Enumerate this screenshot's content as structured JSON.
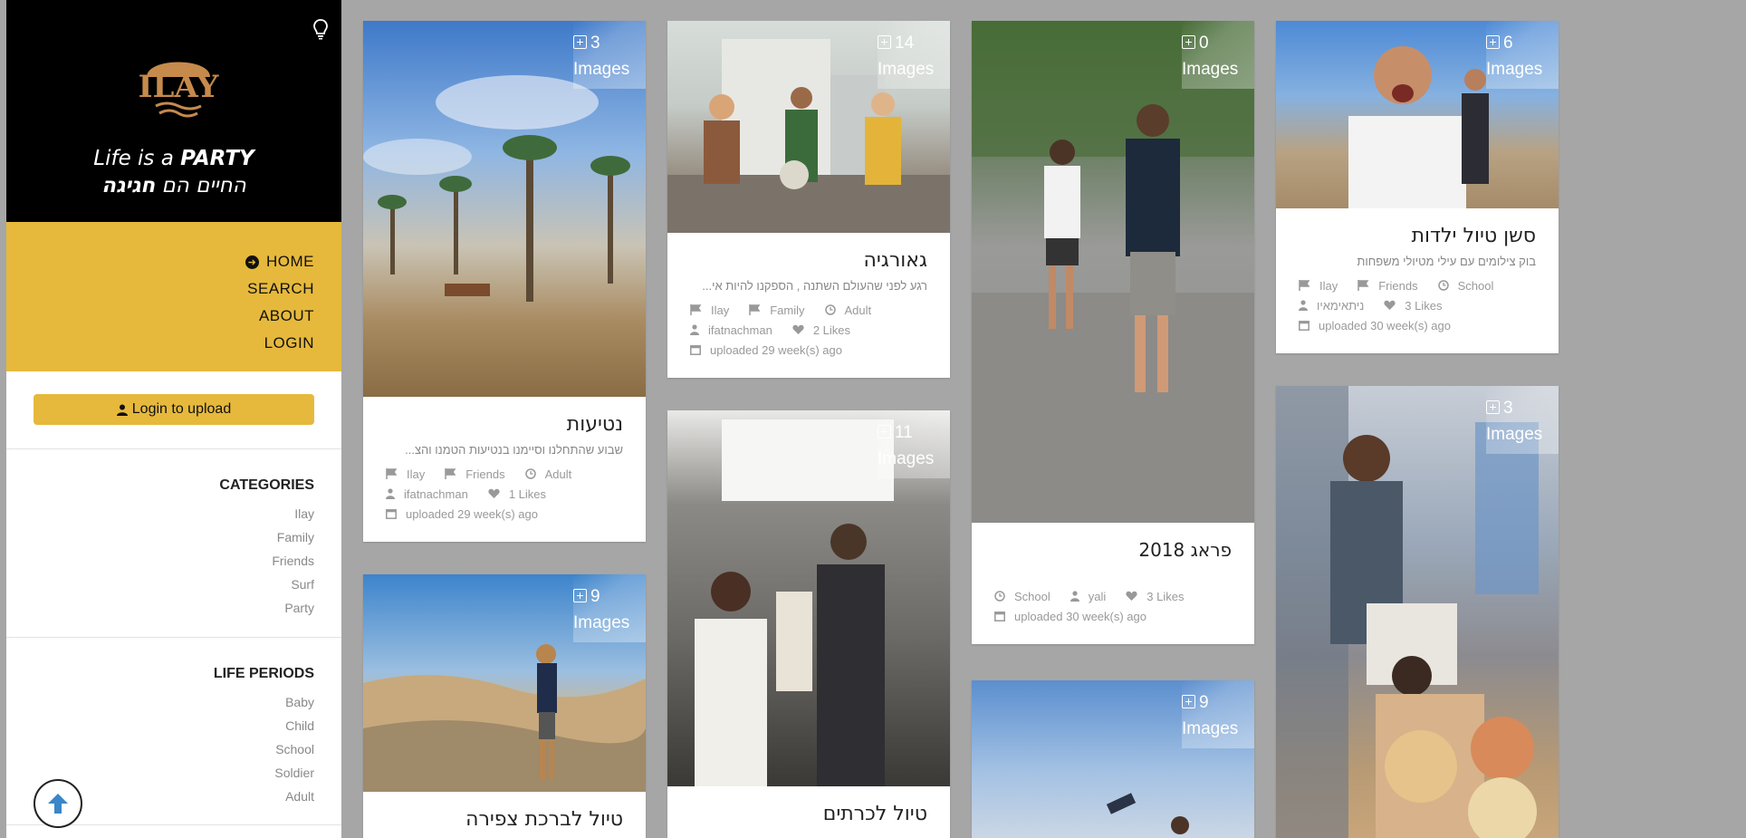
{
  "sidebar": {
    "tagline_line1_pre": "Life is a ",
    "tagline_line1_bold": "PARTY",
    "tagline_line2_pre": "החיים הם ",
    "tagline_line2_bold": "חגיגה",
    "logo_text": "ILAY",
    "nav": [
      {
        "label": "HOME"
      },
      {
        "label": "SEARCH"
      },
      {
        "label": "ABOUT"
      },
      {
        "label": "LOGIN"
      }
    ],
    "login_button": "Login to upload",
    "categories_title": "CATEGORIES",
    "categories": [
      "Ilay",
      "Family",
      "Friends",
      "Surf",
      "Party"
    ],
    "life_periods_title": "LIFE PERIODS",
    "life_periods": [
      "Baby",
      "Child",
      "School",
      "Soldier",
      "Adult"
    ]
  },
  "images_label": "Images",
  "cards": [
    {
      "count": "3",
      "title": "נטיעות",
      "desc": "שבוע שהתחלנו וסיימנו בנטיעות הטמנו והצ...",
      "tags": [
        "Ilay",
        "Friends",
        "Adult"
      ],
      "user": "ifatnachman",
      "likes": "1 Likes",
      "uploaded": "uploaded 29 week(s) ago"
    },
    {
      "count": "9",
      "title": "טיול לברכת צפירה"
    },
    {
      "count": "14",
      "title": "גאורגיה",
      "desc": "רגע לפני שהעולם השתנה , הספקנו להיות אי...",
      "tags": [
        "Ilay",
        "Family",
        "Adult"
      ],
      "user": "ifatnachman",
      "likes": "2 Likes",
      "uploaded": "uploaded 29 week(s) ago"
    },
    {
      "count": "11",
      "title": "טיול לכרתים"
    },
    {
      "count": "0",
      "title": "פראג 2018",
      "tags": [
        "School"
      ],
      "user": "yali",
      "likes": "3 Likes",
      "uploaded": "uploaded 30 week(s) ago"
    },
    {
      "count": "9"
    },
    {
      "count": "6",
      "title": "סשן טיול ילדות",
      "desc": "בוק צילומים עם עילי מטיולי משפחות",
      "tags": [
        "Ilay",
        "Friends",
        "School"
      ],
      "user": "ניתאימאיו",
      "likes": "3 Likes",
      "uploaded": "uploaded 30 week(s) ago"
    },
    {
      "count": "3"
    }
  ]
}
